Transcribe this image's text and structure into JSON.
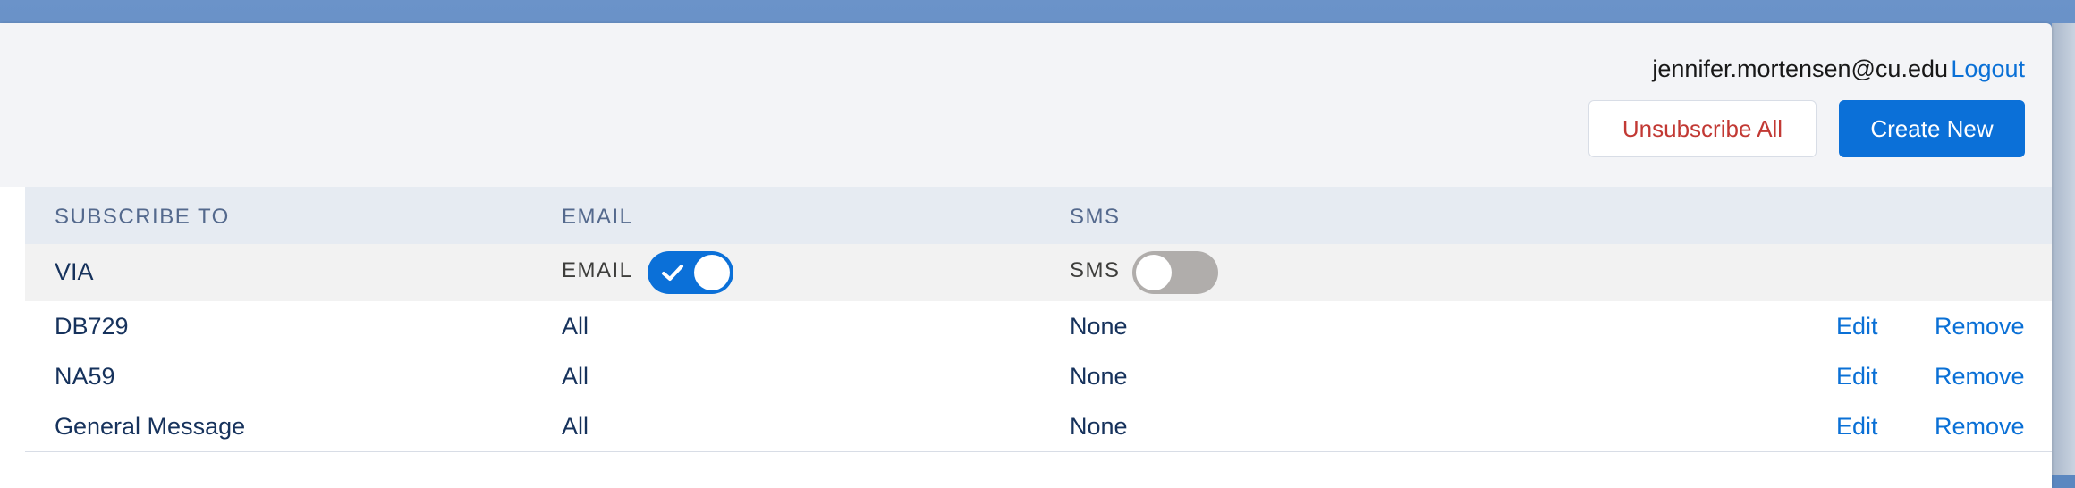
{
  "header": {
    "user_email": "jennifer.mortensen@cu.edu",
    "logout_label": "Logout",
    "unsubscribe_all_label": "Unsubscribe All",
    "create_new_label": "Create New"
  },
  "table": {
    "columns": [
      "SUBSCRIBE TO",
      "EMAIL",
      "SMS"
    ],
    "via_row": {
      "label": "VIA",
      "email_label": "EMAIL",
      "email_enabled": true,
      "sms_label": "SMS",
      "sms_enabled": false
    },
    "rows": [
      {
        "name": "DB729",
        "email": "All",
        "sms": "None",
        "edit": "Edit",
        "remove": "Remove"
      },
      {
        "name": "NA59",
        "email": "All",
        "sms": "None",
        "edit": "Edit",
        "remove": "Remove"
      },
      {
        "name": "General Message",
        "email": "All",
        "sms": "None",
        "edit": "Edit",
        "remove": "Remove"
      }
    ]
  },
  "colors": {
    "accent": "#0b70d8",
    "danger": "#c23934",
    "header_text": "#54698d"
  }
}
